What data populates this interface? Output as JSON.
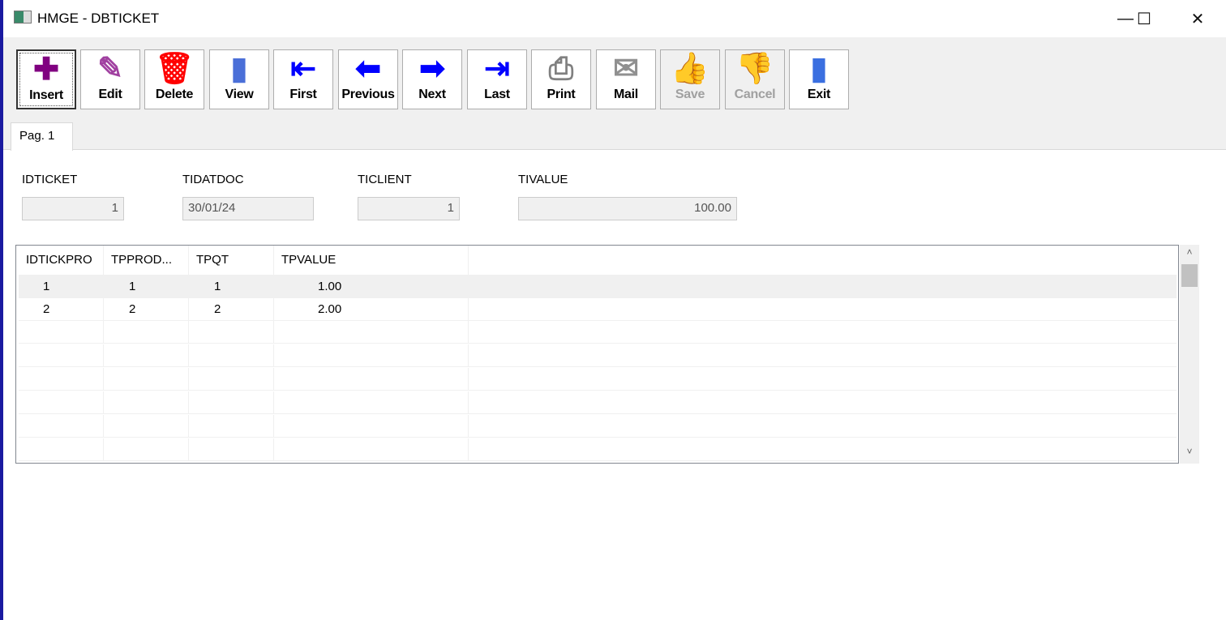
{
  "window": {
    "title": "HMGE - DBTICKET",
    "minimize": "—",
    "maximize": "☐",
    "close": "✕"
  },
  "toolbar": [
    {
      "label": "Insert",
      "icon": "plus-icon",
      "glyph": "✚",
      "color": "#800080",
      "disabled": false
    },
    {
      "label": "Edit",
      "icon": "edit-note-icon",
      "glyph": "✎",
      "color": "#a040a0",
      "disabled": false
    },
    {
      "label": "Delete",
      "icon": "trash-icon",
      "glyph": "🗑",
      "color": "#ff0000",
      "disabled": false
    },
    {
      "label": "View",
      "icon": "book-icon",
      "glyph": "▮",
      "color": "#4a6fd8",
      "disabled": false
    },
    {
      "label": "First",
      "icon": "first-arrow-icon",
      "glyph": "⇤",
      "color": "#0000ff",
      "disabled": false
    },
    {
      "label": "Previous",
      "icon": "left-arrow-icon",
      "glyph": "⬅",
      "color": "#0000ff",
      "disabled": false
    },
    {
      "label": "Next",
      "icon": "right-arrow-icon",
      "glyph": "➡",
      "color": "#0000ff",
      "disabled": false
    },
    {
      "label": "Last",
      "icon": "last-arrow-icon",
      "glyph": "⇥",
      "color": "#0000ff",
      "disabled": false
    },
    {
      "label": "Print",
      "icon": "printer-icon",
      "glyph": "⎙",
      "color": "#808080",
      "disabled": false
    },
    {
      "label": "Mail",
      "icon": "envelope-icon",
      "glyph": "✉",
      "color": "#909090",
      "disabled": false
    },
    {
      "label": "Save",
      "icon": "thumbs-up-icon",
      "glyph": "👍",
      "color": "#a0a0a0",
      "disabled": true
    },
    {
      "label": "Cancel",
      "icon": "thumbs-down-icon",
      "glyph": "👎",
      "color": "#a0a0a0",
      "disabled": true
    },
    {
      "label": "Exit",
      "icon": "door-icon",
      "glyph": "▮",
      "color": "#3a6fe0",
      "disabled": false
    }
  ],
  "tab": {
    "label": "Pag. 1"
  },
  "fields": [
    {
      "label": "IDTICKET",
      "value": "1"
    },
    {
      "label": "TIDATDOC",
      "value": "30/01/24"
    },
    {
      "label": "TICLIENT",
      "value": "1"
    },
    {
      "label": "TIVALUE",
      "value": "100.00"
    }
  ],
  "grid": {
    "columns": [
      "IDTICKPRO",
      "TPPROD...",
      "TPQT",
      "TPVALUE"
    ],
    "rows": [
      [
        "1",
        "1",
        "1",
        "1.00"
      ],
      [
        "2",
        "2",
        "2",
        "2.00"
      ]
    ]
  },
  "scroll": {
    "up": "˄",
    "down": "˅"
  }
}
